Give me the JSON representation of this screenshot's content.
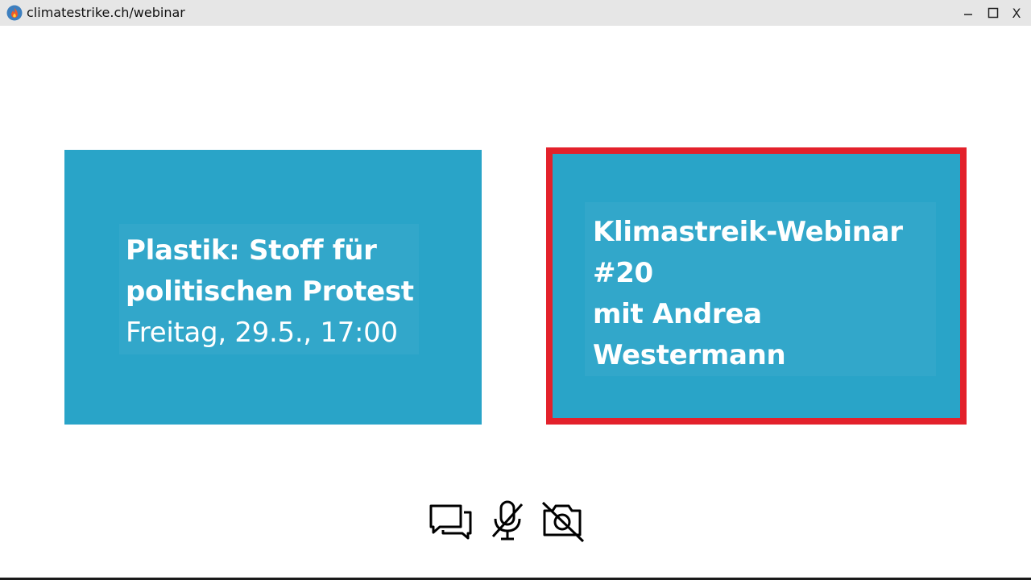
{
  "window": {
    "url": "climatestrike.ch/webinar",
    "site_icon": "flame-logo-icon",
    "controls": {
      "minimize_icon": "minimize-icon",
      "maximize_icon": "maximize-icon",
      "close_label": "X"
    }
  },
  "tiles": {
    "left": {
      "title_line1": "Plastik: Stoff für",
      "title_line2": "politischen Protest",
      "subtitle": "Freitag, 29.5., 17:00",
      "background": "#29a4c8"
    },
    "right": {
      "line1": "Klimastreik-Webinar",
      "line2": "#20",
      "line3": "mit Andrea",
      "line4": "Westermann",
      "background": "#29a4c8",
      "highlight_border": "#e3212b",
      "active_speaker": true
    }
  },
  "controls": {
    "chat": {
      "icon": "chat-bubbles-icon"
    },
    "microphone": {
      "icon": "microphone-muted-icon",
      "muted": true
    },
    "camera": {
      "icon": "camera-off-icon",
      "off": true
    }
  }
}
